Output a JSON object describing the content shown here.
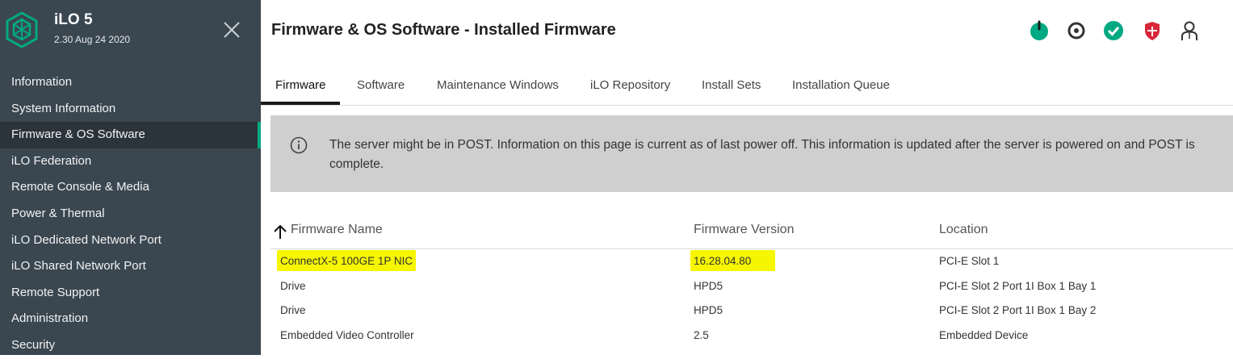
{
  "app": {
    "name": "iLO 5",
    "version": "2.30 Aug 24 2020"
  },
  "sidebar": {
    "items": [
      {
        "label": "Information"
      },
      {
        "label": "System Information"
      },
      {
        "label": "Firmware & OS Software",
        "active": true
      },
      {
        "label": "iLO Federation"
      },
      {
        "label": "Remote Console & Media"
      },
      {
        "label": "Power & Thermal"
      },
      {
        "label": "iLO Dedicated Network Port"
      },
      {
        "label": "iLO Shared Network Port"
      },
      {
        "label": "Remote Support"
      },
      {
        "label": "Administration"
      },
      {
        "label": "Security"
      }
    ]
  },
  "header": {
    "title": "Firmware & OS Software - Installed Firmware",
    "status_icons": [
      "power-icon",
      "locator-icon",
      "health-ok-icon",
      "security-shield-icon",
      "user-icon"
    ]
  },
  "tabs": [
    {
      "label": "Firmware",
      "active": true
    },
    {
      "label": "Software"
    },
    {
      "label": "Maintenance Windows"
    },
    {
      "label": "iLO Repository"
    },
    {
      "label": "Install Sets"
    },
    {
      "label": "Installation Queue"
    }
  ],
  "alert": {
    "icon": "info-icon",
    "text": "The server might be in POST. Information on this page is current as of last power off. This information is updated after the server is powered on and POST is complete."
  },
  "table": {
    "columns": [
      "Firmware Name",
      "Firmware Version",
      "Location"
    ],
    "sort": {
      "column": "Firmware Name",
      "direction": "ascending"
    },
    "rows": [
      {
        "name": "ConnectX-5 100GE 1P NIC",
        "version": "16.28.04.80",
        "location": "PCI-E Slot 1",
        "highlighted": true
      },
      {
        "name": "Drive",
        "version": "HPD5",
        "location": "PCI-E Slot 2 Port 1I Box 1 Bay 1"
      },
      {
        "name": "Drive",
        "version": "HPD5",
        "location": "PCI-E Slot 2 Port 1I Box 1 Bay 2"
      },
      {
        "name": "Embedded Video Controller",
        "version": "2.5",
        "location": "Embedded Device"
      }
    ]
  },
  "colors": {
    "sidebar_bg": "#3a4650",
    "accent": "#01a982",
    "highlight": "#f6f600",
    "alert_bg": "#cfcfcf"
  }
}
